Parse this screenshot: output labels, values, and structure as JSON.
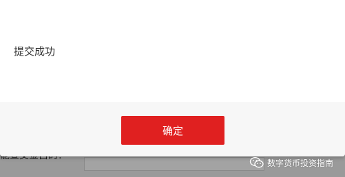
{
  "background": {
    "partial_text": "能查交金白的？"
  },
  "dialog": {
    "message": "提交成功",
    "confirm_label": "确定"
  },
  "watermark": {
    "icon": "wechat-icon",
    "text": "数字货币投资指南"
  },
  "colors": {
    "confirm_button": "#e02020",
    "dialog_footer": "#f7f7f7",
    "overlay": "#9a9a9a"
  }
}
